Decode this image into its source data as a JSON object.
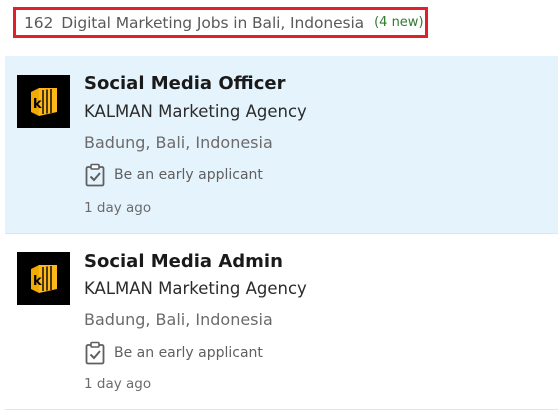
{
  "results": {
    "count": "162",
    "title": "Digital Marketing Jobs in Bali, Indonesia",
    "new_badge": "(4 new)"
  },
  "jobs": [
    {
      "title": "Social Media Officer",
      "company": "KALMAN Marketing Agency",
      "location": "Badung, Bali, Indonesia",
      "insight": "Be an early applicant",
      "posted": "1 day ago",
      "logo_icon": "kalman-logo-icon",
      "selected": true
    },
    {
      "title": "Social Media Admin",
      "company": "KALMAN Marketing Agency",
      "location": "Badung, Bali, Indonesia",
      "insight": "Be an early applicant",
      "posted": "1 day ago",
      "logo_icon": "kalman-logo-icon",
      "selected": false
    }
  ],
  "colors": {
    "highlight_border": "#e0212b",
    "selected_background": "#e5f4fc",
    "new_badge": "#2f7a2f",
    "logo_background": "#000000",
    "logo_gold": "#f2a900"
  }
}
